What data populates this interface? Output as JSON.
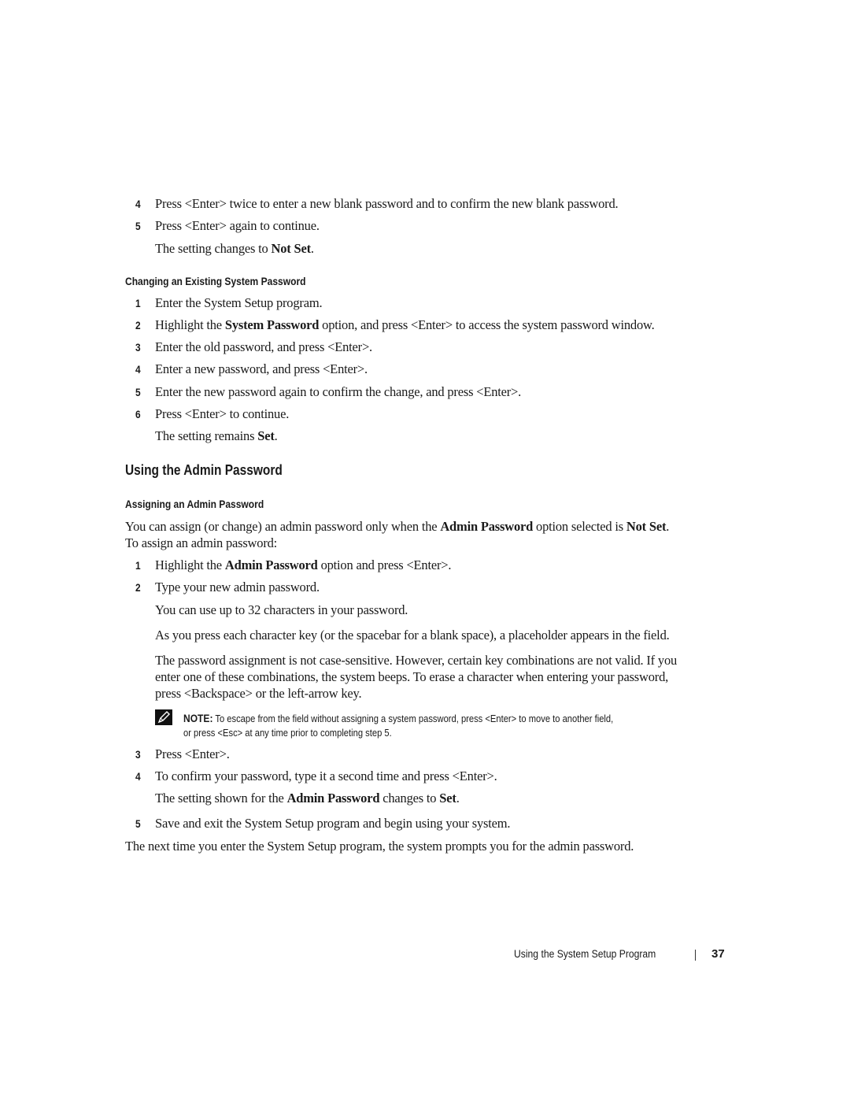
{
  "sections": {
    "blank_steps": [
      {
        "num": "4",
        "text": "Press <Enter> twice to enter a new blank password and to confirm the new blank password."
      },
      {
        "num": "5",
        "text": "Press <Enter> again to continue."
      }
    ],
    "blank_result": {
      "prefix": "The setting changes to ",
      "bold": "Not Set",
      "suffix": "."
    },
    "changing": {
      "heading": "Changing an Existing System Password",
      "steps": [
        {
          "num": "1",
          "text": "Enter the System Setup program."
        },
        {
          "num": "2",
          "prefix": "Highlight the ",
          "bold": "System Password",
          "suffix": " option, and press <Enter> to access the system password window."
        },
        {
          "num": "3",
          "text": "Enter the old password, and press <Enter>."
        },
        {
          "num": "4",
          "text": "Enter a new password, and press <Enter>."
        },
        {
          "num": "5",
          "text": "Enter the new password again to confirm the change, and press <Enter>."
        },
        {
          "num": "6",
          "text": "Press <Enter> to continue."
        }
      ],
      "result": {
        "prefix": "The setting remains ",
        "bold": "Set",
        "suffix": "."
      }
    },
    "admin": {
      "heading": "Using the Admin Password",
      "subheading": "Assigning an Admin Password",
      "intro": {
        "prefix": "You can assign (or change) an admin password only when the ",
        "bold1": "Admin Password",
        "middle": " option selected is ",
        "bold2": "Not Set",
        "suffix": ".",
        "line2": "To assign an admin password:"
      },
      "step1": {
        "num": "1",
        "prefix": "Highlight the ",
        "bold": "Admin Password",
        "suffix": " option and press <Enter>."
      },
      "step2": {
        "num": "2",
        "text": "Type your new admin password."
      },
      "step2_para1": "You can use up to 32 characters in your password.",
      "step2_para2": "As you press each character key (or the spacebar for a blank space), a placeholder appears in the field.",
      "step2_para3_lines": [
        "The password assignment is not case-sensitive. However, certain key combinations are not valid. If you",
        "enter one of these combinations, the system beeps. To erase a character when entering your password,",
        "press <Backspace> or the left-arrow key."
      ],
      "note": {
        "label": "NOTE:",
        "line1": " To escape from the field without assigning a system password, press <Enter> to move to another field,",
        "line2": "or press <Esc> at any time prior to completing step 5."
      },
      "step3": {
        "num": "3",
        "text": "Press <Enter>."
      },
      "step4": {
        "num": "4",
        "text": "To confirm your password, type it a second time and press <Enter>."
      },
      "step4_result": {
        "prefix": "The setting shown for the ",
        "bold1": "Admin Password",
        "middle": " changes to ",
        "bold2": "Set",
        "suffix": "."
      },
      "step5": {
        "num": "5",
        "text": "Save and exit the System Setup program and begin using your system."
      },
      "closing": "The next time you enter the System Setup program, the system prompts you for the admin password."
    }
  },
  "footer": {
    "title": "Using the System Setup Program",
    "page": "37"
  }
}
